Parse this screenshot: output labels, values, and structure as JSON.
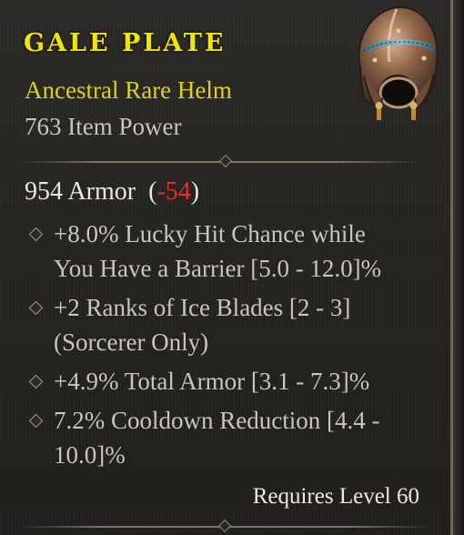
{
  "item": {
    "name": "GALE PLATE",
    "type": "Ancestral Rare Helm",
    "item_power": "763 Item Power",
    "icon": "helm-icon"
  },
  "armor": {
    "value": "954 Armor",
    "open": "(",
    "delta": "-54",
    "close": ")"
  },
  "affixes": [
    {
      "line1": "+8.0% Lucky Hit Chance while",
      "line2": "You Have a Barrier [5.0 - 12.0]%"
    },
    {
      "line1": "+2 Ranks of Ice Blades [2 - 3]",
      "line2": "(Sorcerer Only)"
    },
    {
      "line1": "+4.9% Total Armor [3.1 - 7.3]%",
      "line2": ""
    },
    {
      "line1": "7.2% Cooldown Reduction [4.4 -",
      "line2": "10.0]%"
    }
  ],
  "requirement": "Requires Level 60",
  "colors": {
    "rare_yellow": "#f1e600",
    "type_yellow": "#dcd21b",
    "negative_red": "#e0332a",
    "text_light": "#ece8df",
    "text_muted": "#c9c5bb"
  }
}
